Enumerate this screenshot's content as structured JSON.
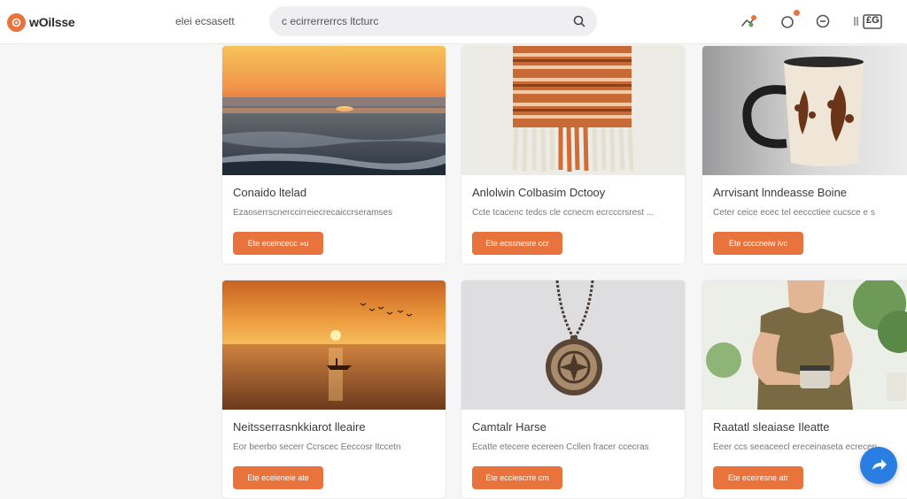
{
  "header": {
    "logo_text": "wOilsse",
    "nav_link": "elei ecsasett",
    "search_text": "c ecirrerrerrcs ltcturc",
    "icons": [
      "trend-icon",
      "notification-icon",
      "settings-icon",
      "wallet-icon"
    ],
    "wallet_label": "£G"
  },
  "products": [
    {
      "title": "Conaido ltelad",
      "desc": "Ezaoserrscnerccirreiecrecaiccrseramses",
      "button": "Ete eceincecc »u"
    },
    {
      "title": "Anlolwin Colbasim Dctooy",
      "desc": "Ccte tcacenc tedcs cle ccnecm ecrcccrsrest ...",
      "button": "Ete ecssnesre ccr"
    },
    {
      "title": "Arrvisant lnndeasse Boine",
      "desc": "Ceter ceice ecec tel eeccctiee cucsce e s",
      "button": "Ete ccccneiw ivc"
    },
    {
      "title": "Neitsserrasnkkiarot lleaire",
      "desc": "Eor beerbo secerr Ccrscec Eeccosr ltccetn",
      "button": "Ete eceieneie ate"
    },
    {
      "title": "Camtalr Harse",
      "desc": "Ecatte etecere ecereen Ccllen fracer ccecras",
      "button": "Ete ecciescrre cm"
    },
    {
      "title": "Raatatl sleaiase Ileatte",
      "desc": "Eeer ccs seeaceecl ereceinaseta ecrecen",
      "button": "Ete eceiresne atr"
    }
  ],
  "colors": {
    "accent": "#e8733c",
    "fab": "#2a7de1"
  },
  "fab_icon": "share-arrow-icon"
}
